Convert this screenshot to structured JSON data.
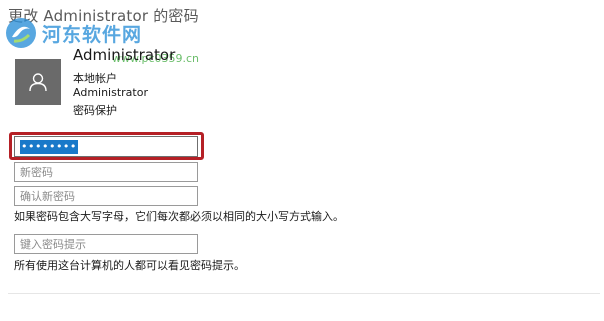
{
  "dialog": {
    "title": "更改 Administrator 的密码"
  },
  "watermark": {
    "site_name": "河东软件网",
    "url_text": "www.pc0359.cn"
  },
  "account": {
    "display_name": "Administrator",
    "type": "本地帐户",
    "username": "Administrator",
    "protection": "密码保护"
  },
  "form": {
    "current_password": {
      "value": "••••••••",
      "selected": true
    },
    "new_password": {
      "placeholder": "新密码"
    },
    "confirm_password": {
      "placeholder": "确认新密码"
    },
    "case_note": "如果密码包含大写字母，它们每次都必须以相同的大小写方式输入。",
    "hint": {
      "placeholder": "键入密码提示"
    },
    "hint_note": "所有使用这台计算机的人都可以看见密码提示。"
  },
  "colors": {
    "highlight_border": "#b52026",
    "selection": "#1979c9",
    "avatar_bg": "#6a6a6a",
    "title_text": "#5a5a5a"
  },
  "icons": {
    "avatar": "user-icon",
    "watermark_logo": "site-logo-icon"
  }
}
